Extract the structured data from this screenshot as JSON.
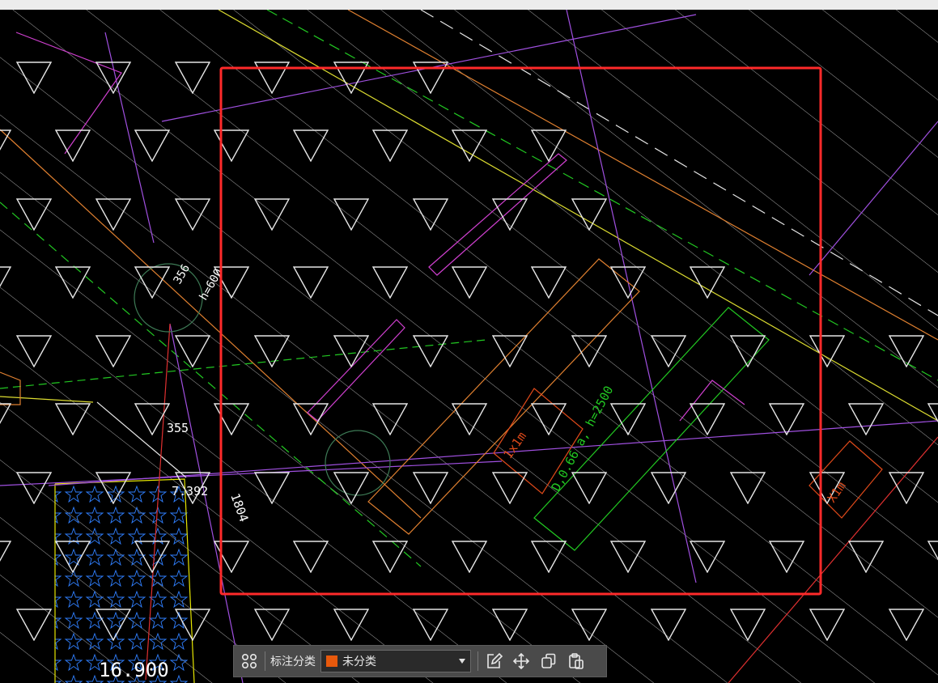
{
  "drawing": {
    "annotations": [
      {
        "id": "dim-356",
        "text": "356",
        "color": "#ffffff"
      },
      {
        "id": "dim-h600",
        "text": "h=600",
        "color": "#ffffff"
      },
      {
        "id": "dim-355",
        "text": "355",
        "color": "#ffffff"
      },
      {
        "id": "dim-1804",
        "text": "1804",
        "color": "#ffffff"
      },
      {
        "id": "dim-7392",
        "text": "7.392",
        "color": "#ffffff"
      },
      {
        "id": "elev-16900",
        "text": "16.900",
        "color": "#ffffff"
      },
      {
        "id": "pipe-label",
        "text": "D,0.66 a, h=2500",
        "color": "#22c922"
      },
      {
        "id": "box-label-1",
        "text": "1x1m",
        "color": "#e04a1a"
      },
      {
        "id": "box-label-2",
        "text": "X1m",
        "color": "#e04a1a"
      }
    ],
    "selection_color": "#ff2a2a",
    "background": "#000000"
  },
  "toolbar": {
    "label": "标注分类",
    "selected_category": "未分类",
    "category_color": "#e8590c",
    "icons": [
      "grid-icon",
      "edit-icon",
      "move-icon",
      "copy-icon",
      "paste-icon"
    ]
  }
}
